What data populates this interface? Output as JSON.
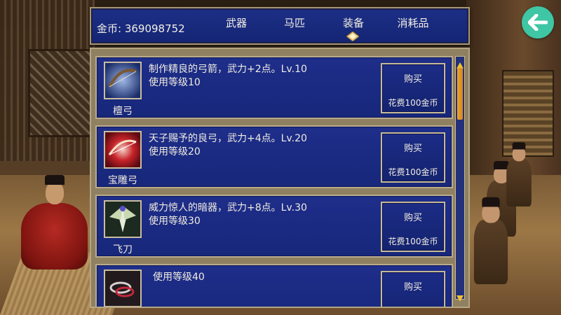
{
  "header": {
    "gold_label": "金币: 369098752",
    "tabs": [
      {
        "label": "武器"
      },
      {
        "label": "马匹"
      },
      {
        "label": "装备"
      },
      {
        "label": "消耗品"
      }
    ],
    "active_tab_badge": "diamond-badge-icon"
  },
  "back_button": {
    "icon": "back-arrow-icon",
    "color": "#3fc6a4"
  },
  "items": [
    {
      "name": "檀弓",
      "desc_line1": "制作精良的弓箭，武力+2点。Lv.10",
      "desc_line2": "使用等级10",
      "icon": "bow-icon",
      "buy_label": "购买",
      "cost": "花费100金币"
    },
    {
      "name": "宝雕弓",
      "desc_line1": "天子赐予的良弓，武力+4点。Lv.20",
      "desc_line2": "使用等级20",
      "icon": "red-bow-icon",
      "buy_label": "购买",
      "cost": "花费100金币"
    },
    {
      "name": "飞刀",
      "desc_line1": "威力惊人的暗器，武力+8点。Lv.30",
      "desc_line2": "使用等级30",
      "icon": "flying-knife-icon",
      "buy_label": "购买",
      "cost": "花费100金币"
    },
    {
      "name": "",
      "desc_line1": "使用等级40",
      "icon": "chain-icon",
      "buy_label": "购买"
    }
  ],
  "colors": {
    "panel_blue": "#17277a",
    "frame_gold": "#b9ab8c",
    "scroll_thumb": "#f0a429",
    "back_button": "#3fc6a4"
  }
}
